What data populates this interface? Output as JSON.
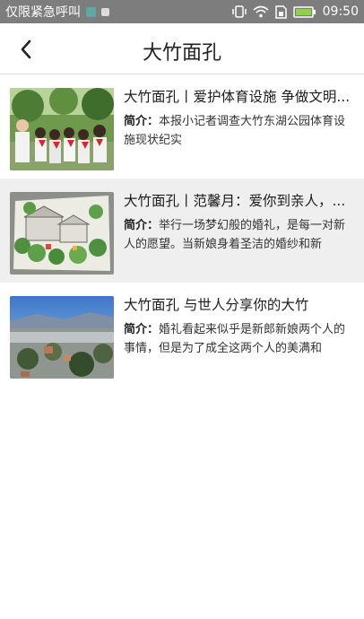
{
  "status_bar": {
    "carrier_text": "仅限紧急呼叫",
    "time": "09:50",
    "icons": [
      "notification-icon",
      "image-icon",
      "vibrate-icon",
      "wifi-icon",
      "sim-icon",
      "battery-icon"
    ]
  },
  "header": {
    "back_icon": "back-arrow-icon",
    "title": "大竹面孔"
  },
  "summary_label": "简介：",
  "articles": [
    {
      "title": "大竹面孔丨爱护体育设施 争做文明...",
      "summary": "本报小记者调查大竹东湖公园体育设施现状纪实",
      "thumbnail": "children-in-park-photo"
    },
    {
      "title": "大竹面孔丨范馨月：爱你到亲人，...",
      "summary": "举行一场梦幻般的婚礼，是每一对新人的愿望。当新娘身着圣洁的婚纱和新",
      "thumbnail": "painted-village-artwork-photo"
    },
    {
      "title": "大竹面孔 与世人分享你的大竹",
      "summary": "婚礼看起来似乎是新郎新娘两个人的事情，但是为了成全这两个人的美满和",
      "thumbnail": "misty-landscape-photo"
    }
  ]
}
